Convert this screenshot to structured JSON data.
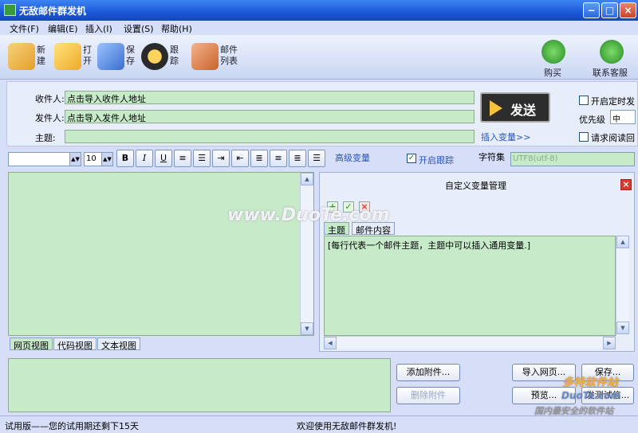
{
  "window": {
    "title": "无敌邮件群发机"
  },
  "menu": [
    "文件(F)",
    "编辑(E)",
    "插入(I)",
    "设置(S)",
    "帮助(H)"
  ],
  "toolbar": {
    "new": "新建",
    "open": "打开",
    "save": "保存",
    "track": "跟踪",
    "mail_list": "邮件列表",
    "buy": "购买",
    "contact": "联系客服"
  },
  "form": {
    "to_label": "收件人:",
    "to_value": "点击导入收件人地址",
    "from_label": "发件人:",
    "from_value": "点击导入发件人地址",
    "subject_label": "主题:",
    "subject_value": "",
    "send": "发送",
    "insert_variable": "插入变量>>",
    "scheduled_send": "开启定时发",
    "priority_label": "优先级",
    "priority_value": "中",
    "read_receipt": "请求阅读回",
    "scheduled_checked": false,
    "read_receipt_checked": false
  },
  "format": {
    "font_value": "",
    "size_value": "10",
    "bold": "B",
    "italic": "I",
    "underline": "U",
    "advanced_variable": "高级变量",
    "enable_tracking": "开启跟踪",
    "enable_tracking_checked": true,
    "charset_label": "字符集",
    "charset_value": "UTF8(utf-8)"
  },
  "editor_tabs": [
    "网页视图",
    "代码视图",
    "文本视图"
  ],
  "variables": {
    "title": "自定义变量管理",
    "tabs": [
      "主题",
      "邮件内容"
    ],
    "content": "[每行代表一个邮件主题，主题中可以插入通用变量.]"
  },
  "buttons": {
    "add_attachment": "添加附件...",
    "remove_attachment": "删除附件",
    "import_page": "导入网页...",
    "save": "保存...",
    "preview": "预览...",
    "send_test": "发测试信..."
  },
  "status": {
    "left": "试用版——您的试用期还剩下15天",
    "right": "欢迎使用无敌邮件群发机!"
  },
  "watermarks": {
    "center": "www.DuoTe.com",
    "corner_brand": "多特软件站",
    "corner_url": "DuoTe.com",
    "corner_slogan": "国内最安全的软件站"
  },
  "colors": {
    "input_green": "#c7ebc9",
    "title_blue": "#1c58d8",
    "link_blue": "#2955b8"
  }
}
